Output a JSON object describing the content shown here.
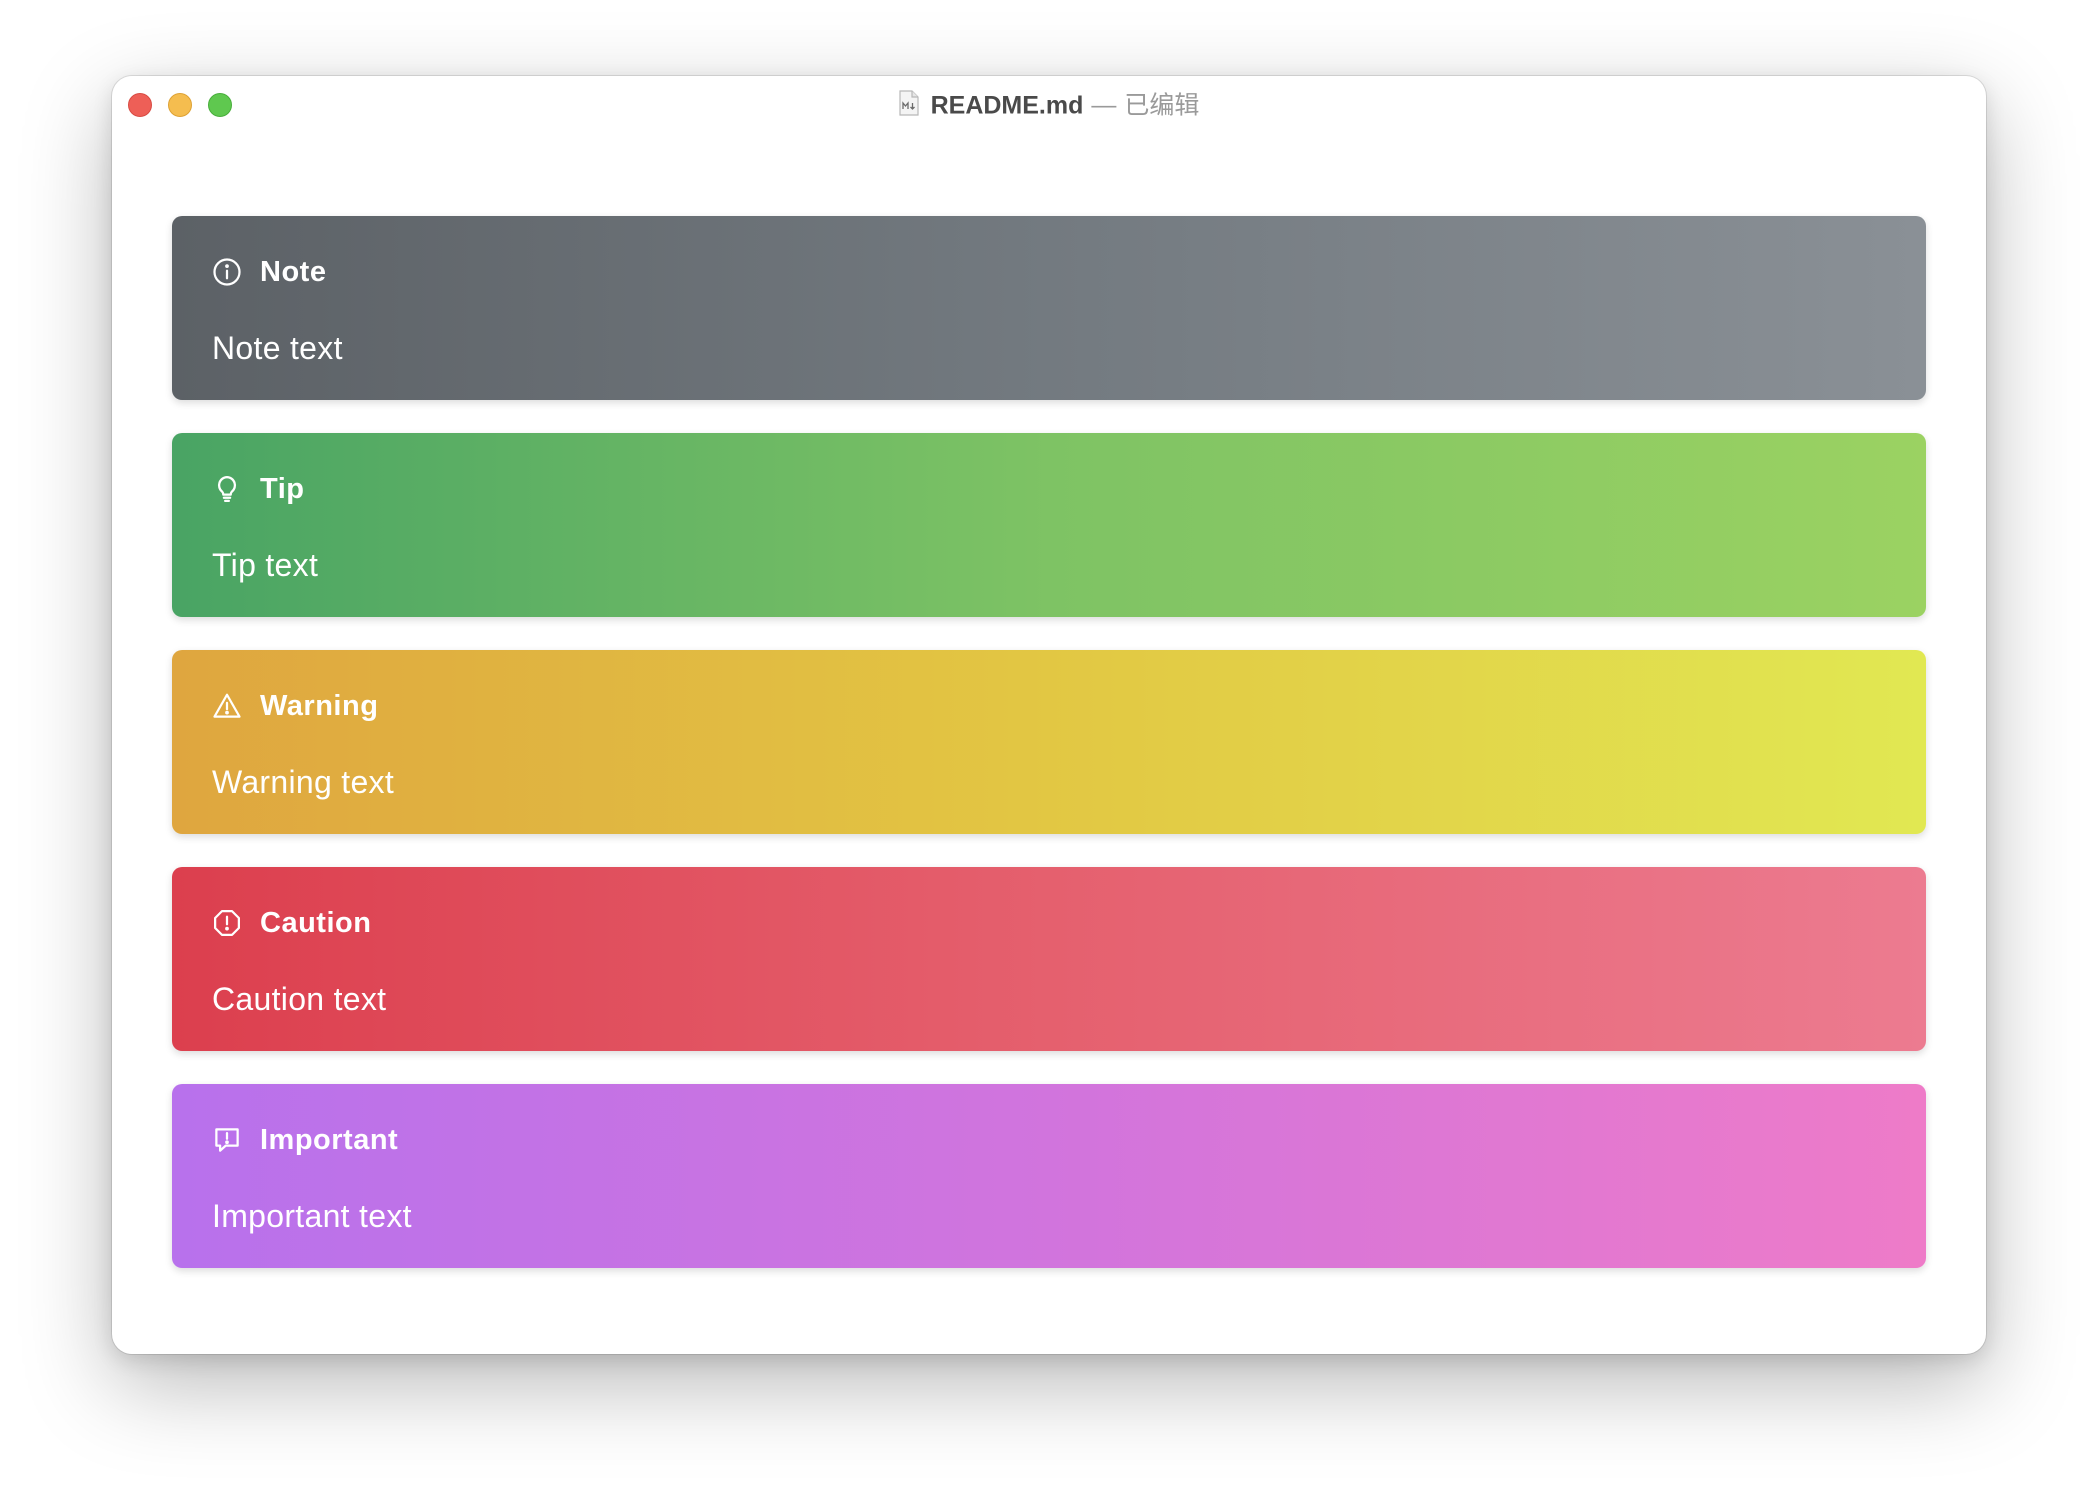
{
  "window": {
    "file_name": "README.md",
    "separator": "—",
    "status": "已编辑",
    "file_icon": "markdown-file-icon"
  },
  "traffic_lights": {
    "close_color": "#ee5f57",
    "minimize_color": "#f5bd4f",
    "zoom_color": "#5fc84f"
  },
  "callouts": [
    {
      "type": "note",
      "icon": "info-circle-icon",
      "label": "Note",
      "text": "Note text"
    },
    {
      "type": "tip",
      "icon": "lightbulb-icon",
      "label": "Tip",
      "text": "Tip text"
    },
    {
      "type": "warning",
      "icon": "warning-triangle-icon",
      "label": "Warning",
      "text": "Warning text"
    },
    {
      "type": "caution",
      "icon": "alert-octagon-icon",
      "label": "Caution",
      "text": "Caution text"
    },
    {
      "type": "important",
      "icon": "comment-alert-icon",
      "label": "Important",
      "text": "Important text"
    }
  ]
}
